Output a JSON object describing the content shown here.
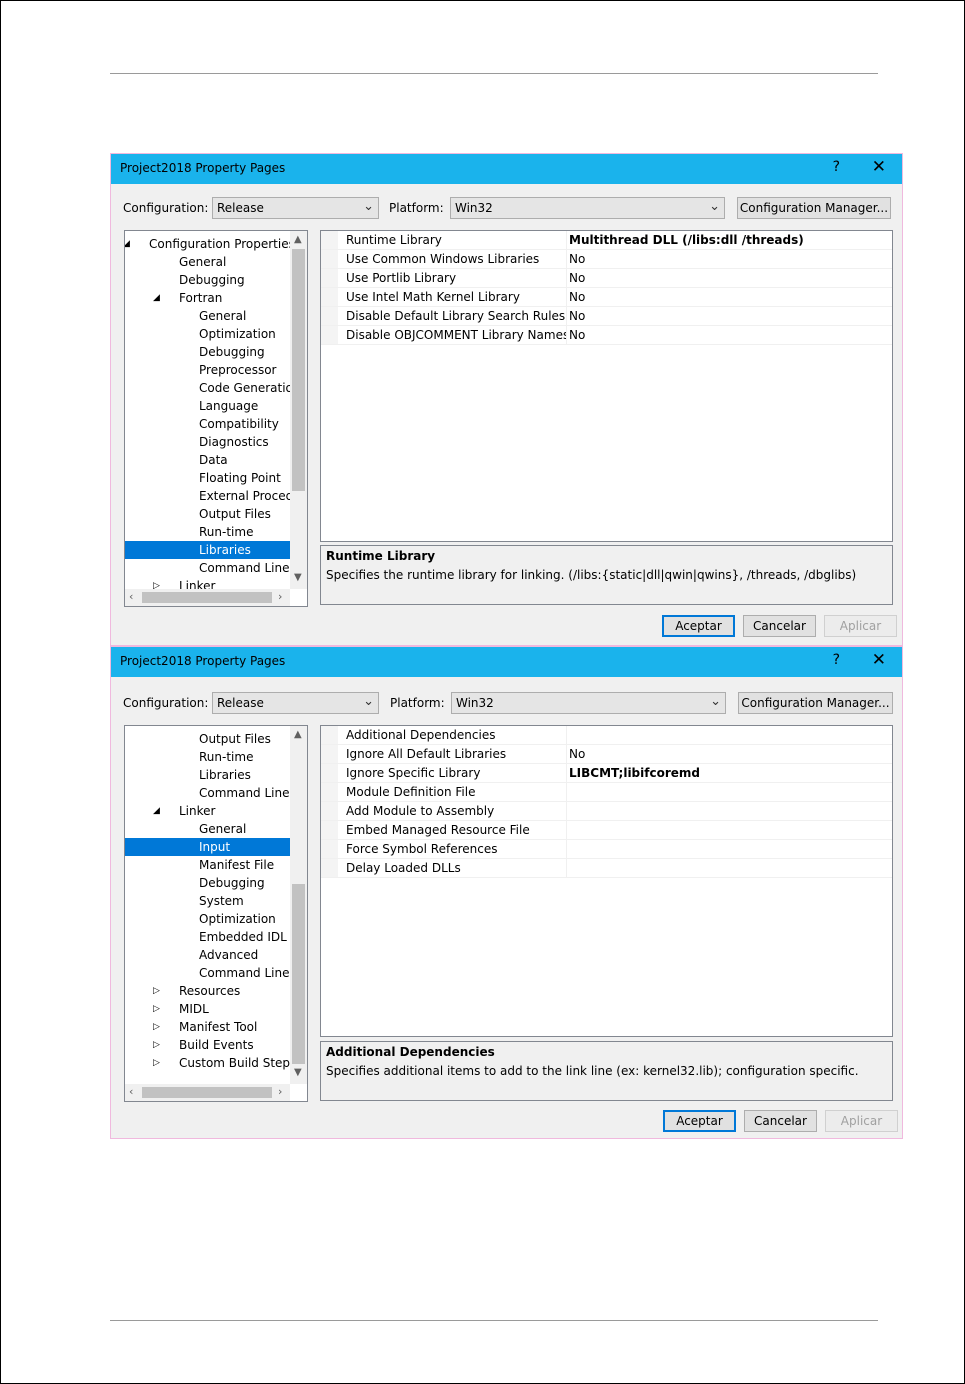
{
  "dialog1": {
    "title": "Project2018 Property Pages",
    "help": "?",
    "close": "✕",
    "configuration_label": "Configuration:",
    "configuration_value": "Release",
    "platform_label": "Platform:",
    "platform_value": "Win32",
    "config_manager": "Configuration Manager...",
    "tree": [
      {
        "label": "Configuration Properties",
        "level": 0,
        "expander": "◢"
      },
      {
        "label": "General",
        "level": 1,
        "expander": ""
      },
      {
        "label": "Debugging",
        "level": 1,
        "expander": ""
      },
      {
        "label": "Fortran",
        "level": 1,
        "expander": "◢"
      },
      {
        "label": "General",
        "level": 2,
        "expander": ""
      },
      {
        "label": "Optimization",
        "level": 2,
        "expander": ""
      },
      {
        "label": "Debugging",
        "level": 2,
        "expander": ""
      },
      {
        "label": "Preprocessor",
        "level": 2,
        "expander": ""
      },
      {
        "label": "Code Generation",
        "level": 2,
        "expander": ""
      },
      {
        "label": "Language",
        "level": 2,
        "expander": ""
      },
      {
        "label": "Compatibility",
        "level": 2,
        "expander": ""
      },
      {
        "label": "Diagnostics",
        "level": 2,
        "expander": ""
      },
      {
        "label": "Data",
        "level": 2,
        "expander": ""
      },
      {
        "label": "Floating Point",
        "level": 2,
        "expander": ""
      },
      {
        "label": "External Procedures",
        "level": 2,
        "expander": ""
      },
      {
        "label": "Output Files",
        "level": 2,
        "expander": ""
      },
      {
        "label": "Run-time",
        "level": 2,
        "expander": ""
      },
      {
        "label": "Libraries",
        "level": 2,
        "expander": "",
        "selected": true
      },
      {
        "label": "Command Line",
        "level": 2,
        "expander": ""
      },
      {
        "label": "Linker",
        "level": 1,
        "expander": "▷"
      }
    ],
    "properties": [
      {
        "name": "Runtime Library",
        "value": "Multithread DLL (/libs:dll /threads)",
        "bold": true
      },
      {
        "name": "Use Common Windows Libraries",
        "value": "No",
        "bold": false
      },
      {
        "name": "Use Portlib Library",
        "value": "No",
        "bold": false
      },
      {
        "name": "Use Intel Math Kernel Library",
        "value": "No",
        "bold": false
      },
      {
        "name": "Disable Default Library Search Rules",
        "value": "No",
        "bold": false
      },
      {
        "name": "Disable OBJCOMMENT Library Names in Object",
        "value": "No",
        "bold": false
      }
    ],
    "desc_title": "Runtime Library",
    "desc_text": "Specifies the runtime library for linking. (/libs:{static|dll|qwin|qwins}, /threads, /dbglibs)",
    "ok": "Aceptar",
    "cancel": "Cancelar",
    "apply": "Aplicar",
    "scroll_position": 0.55
  },
  "dialog2": {
    "title": "Project2018 Property Pages",
    "help": "?",
    "close": "✕",
    "configuration_label": "Configuration:",
    "configuration_value": "Release",
    "platform_label": "Platform:",
    "platform_value": "Win32",
    "config_manager": "Configuration Manager...",
    "tree": [
      {
        "label": "Output Files",
        "level": 2,
        "expander": ""
      },
      {
        "label": "Run-time",
        "level": 2,
        "expander": ""
      },
      {
        "label": "Libraries",
        "level": 2,
        "expander": ""
      },
      {
        "label": "Command Line",
        "level": 2,
        "expander": ""
      },
      {
        "label": "Linker",
        "level": 1,
        "expander": "◢"
      },
      {
        "label": "General",
        "level": 2,
        "expander": ""
      },
      {
        "label": "Input",
        "level": 2,
        "expander": "",
        "selected": true
      },
      {
        "label": "Manifest File",
        "level": 2,
        "expander": ""
      },
      {
        "label": "Debugging",
        "level": 2,
        "expander": ""
      },
      {
        "label": "System",
        "level": 2,
        "expander": ""
      },
      {
        "label": "Optimization",
        "level": 2,
        "expander": ""
      },
      {
        "label": "Embedded IDL",
        "level": 2,
        "expander": ""
      },
      {
        "label": "Advanced",
        "level": 2,
        "expander": ""
      },
      {
        "label": "Command Line",
        "level": 2,
        "expander": ""
      },
      {
        "label": "Resources",
        "level": 1,
        "expander": "▷"
      },
      {
        "label": "MIDL",
        "level": 1,
        "expander": "▷"
      },
      {
        "label": "Manifest Tool",
        "level": 1,
        "expander": "▷"
      },
      {
        "label": "Build Events",
        "level": 1,
        "expander": "▷"
      },
      {
        "label": "Custom Build Step",
        "level": 1,
        "expander": "▷"
      }
    ],
    "properties": [
      {
        "name": "Additional Dependencies",
        "value": "",
        "bold": false
      },
      {
        "name": "Ignore All Default Libraries",
        "value": "No",
        "bold": false
      },
      {
        "name": "Ignore Specific Library",
        "value": "LIBCMT;libifcoremd",
        "bold": true
      },
      {
        "name": "Module Definition File",
        "value": "",
        "bold": false
      },
      {
        "name": "Add Module to Assembly",
        "value": "",
        "bold": false
      },
      {
        "name": "Embed Managed Resource File",
        "value": "",
        "bold": false
      },
      {
        "name": "Force Symbol References",
        "value": "",
        "bold": false
      },
      {
        "name": "Delay Loaded DLLs",
        "value": "",
        "bold": false
      }
    ],
    "desc_title": "Additional Dependencies",
    "desc_text": "Specifies additional items to add to the link line (ex: kernel32.lib); configuration specific.",
    "ok": "Aceptar",
    "cancel": "Cancelar",
    "apply": "Aplicar",
    "scroll_position": 0.46
  }
}
